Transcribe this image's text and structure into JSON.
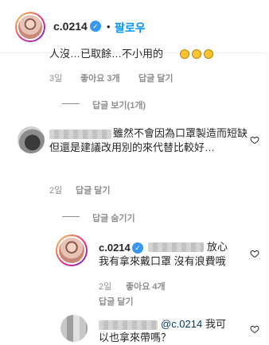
{
  "header": {
    "username": "c.0214",
    "separator": "•",
    "follow_label": "팔로우",
    "verified_glyph": "✓"
  },
  "partial_comment": {
    "text": "人沒…已取餘…不小用的"
  },
  "comment1_meta": {
    "time": "3일",
    "likes": "좋아요 3개",
    "reply": "답글 달기"
  },
  "view_replies": "답글 보기(1개)",
  "comment2": {
    "text": "雖然不會因為口罩製造而短缺但還是建議改用別的來代替比較好…",
    "time": "2일",
    "reply": "답글 달기"
  },
  "hide_replies": "답글 숨기기",
  "reply1": {
    "username": "c.0214",
    "verified_glyph": "✓",
    "text_tail": "放心",
    "text_line2": "我有拿來戴口罩 沒有浪費哦",
    "time": "2일",
    "likes": "좋아요 4개",
    "reply": "답글 달기"
  },
  "comment3": {
    "mention": "@c.0214",
    "text_after": " 我可",
    "text_line2": "以也拿來帶嗎？"
  },
  "icons": {
    "heart": "heart-icon",
    "verified": "verified-badge-icon"
  },
  "colors": {
    "link_blue": "#0095f6",
    "verified_blue": "#3897f0",
    "meta_gray": "#8e8e8e",
    "mention_blue": "#00376b"
  }
}
